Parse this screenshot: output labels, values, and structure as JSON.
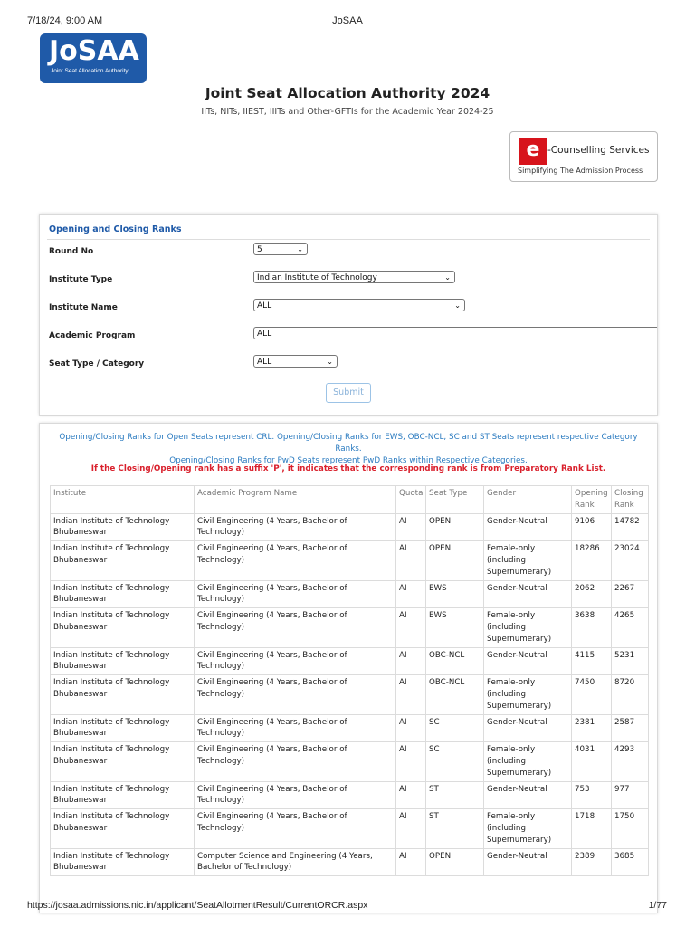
{
  "print_header": {
    "datetime": "7/18/24, 9:00 AM",
    "page_title": "JoSAA"
  },
  "logo": {
    "main": "JoSAA",
    "sub": "Joint Seat Allocation Authority",
    "color": "#1f5aa8"
  },
  "header": {
    "title": "Joint Seat Allocation Authority 2024",
    "subtitle": "IITs, NITs, IIEST, IIITs and Other-GFTIs for the Academic Year 2024-25"
  },
  "ecounselling": {
    "logo_letter": "e",
    "title": "-Counselling Services",
    "tagline": "Simplifying The Admission Process"
  },
  "form": {
    "heading": "Opening and Closing Ranks",
    "fields": [
      {
        "label": "Round No",
        "value": "5"
      },
      {
        "label": "Institute Type",
        "value": "Indian Institute of Technology"
      },
      {
        "label": "Institute Name",
        "value": "ALL"
      },
      {
        "label": "Academic Program",
        "value": "ALL"
      },
      {
        "label": "Seat Type / Category",
        "value": "ALL"
      }
    ],
    "submit_label": "Submit"
  },
  "notes": {
    "line1": "Opening/Closing Ranks for Open Seats represent CRL. Opening/Closing Ranks for EWS, OBC-NCL, SC and ST Seats represent respective Category Ranks.",
    "line2": "Opening/Closing Ranks for PwD Seats represent PwD Ranks within Respective Categories.",
    "warning": "If the Closing/Opening rank has a suffix 'P', it indicates that the corresponding rank is from Preparatory Rank List."
  },
  "table": {
    "headers": [
      "Institute",
      "Academic Program Name",
      "Quota",
      "Seat Type",
      "Gender",
      "Opening Rank",
      "Closing Rank"
    ],
    "rows": [
      [
        "Indian Institute of Technology Bhubaneswar",
        "Civil Engineering (4 Years, Bachelor of Technology)",
        "AI",
        "OPEN",
        "Gender-Neutral",
        "9106",
        "14782"
      ],
      [
        "Indian Institute of Technology Bhubaneswar",
        "Civil Engineering (4 Years, Bachelor of Technology)",
        "AI",
        "OPEN",
        "Female-only (including Supernumerary)",
        "18286",
        "23024"
      ],
      [
        "Indian Institute of Technology Bhubaneswar",
        "Civil Engineering (4 Years, Bachelor of Technology)",
        "AI",
        "EWS",
        "Gender-Neutral",
        "2062",
        "2267"
      ],
      [
        "Indian Institute of Technology Bhubaneswar",
        "Civil Engineering (4 Years, Bachelor of Technology)",
        "AI",
        "EWS",
        "Female-only (including Supernumerary)",
        "3638",
        "4265"
      ],
      [
        "Indian Institute of Technology Bhubaneswar",
        "Civil Engineering (4 Years, Bachelor of Technology)",
        "AI",
        "OBC-NCL",
        "Gender-Neutral",
        "4115",
        "5231"
      ],
      [
        "Indian Institute of Technology Bhubaneswar",
        "Civil Engineering (4 Years, Bachelor of Technology)",
        "AI",
        "OBC-NCL",
        "Female-only (including Supernumerary)",
        "7450",
        "8720"
      ],
      [
        "Indian Institute of Technology Bhubaneswar",
        "Civil Engineering (4 Years, Bachelor of Technology)",
        "AI",
        "SC",
        "Gender-Neutral",
        "2381",
        "2587"
      ],
      [
        "Indian Institute of Technology Bhubaneswar",
        "Civil Engineering (4 Years, Bachelor of Technology)",
        "AI",
        "SC",
        "Female-only (including Supernumerary)",
        "4031",
        "4293"
      ],
      [
        "Indian Institute of Technology Bhubaneswar",
        "Civil Engineering (4 Years, Bachelor of Technology)",
        "AI",
        "ST",
        "Gender-Neutral",
        "753",
        "977"
      ],
      [
        "Indian Institute of Technology Bhubaneswar",
        "Civil Engineering (4 Years, Bachelor of Technology)",
        "AI",
        "ST",
        "Female-only (including Supernumerary)",
        "1718",
        "1750"
      ],
      [
        "Indian Institute of Technology Bhubaneswar",
        "Computer Science and Engineering (4 Years, Bachelor of Technology)",
        "AI",
        "OPEN",
        "Gender-Neutral",
        "2389",
        "3685"
      ]
    ]
  },
  "footer": {
    "url": "https://josaa.admissions.nic.in/applicant/SeatAllotmentResult/CurrentORCR.aspx",
    "page": "1/77"
  }
}
